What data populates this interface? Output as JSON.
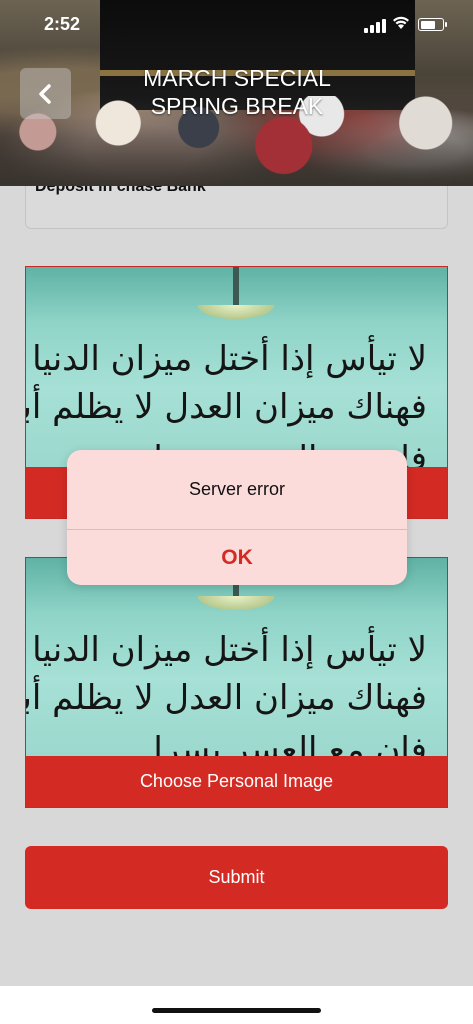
{
  "status_bar": {
    "time": "2:52"
  },
  "header": {
    "title": "MARCH SPECIAL SPRING BREAK"
  },
  "form": {
    "deposit_field_value": "Deposit in chase Bank",
    "card1": {
      "image_text": [
        "لا تيأس إذا أختل ميزان الدنيا",
        "فهناك ميزان العدل لا يظلم أبداً",
        "فإن مع العسر يسرا"
      ]
    },
    "card2": {
      "image_text": [
        "لا تيأس إذا أختل ميزان الدنيا",
        "فهناك ميزان العدل لا يظلم أبداً",
        "فإن مع العسر يسرا"
      ],
      "button_label": "Choose Personal Image"
    },
    "submit_label": "Submit"
  },
  "alert": {
    "message": "Server error",
    "ok_label": "OK"
  },
  "colors": {
    "accent": "#d42a24",
    "alert_bg": "#fbdcdb",
    "page_bg": "#d8d8d8"
  }
}
